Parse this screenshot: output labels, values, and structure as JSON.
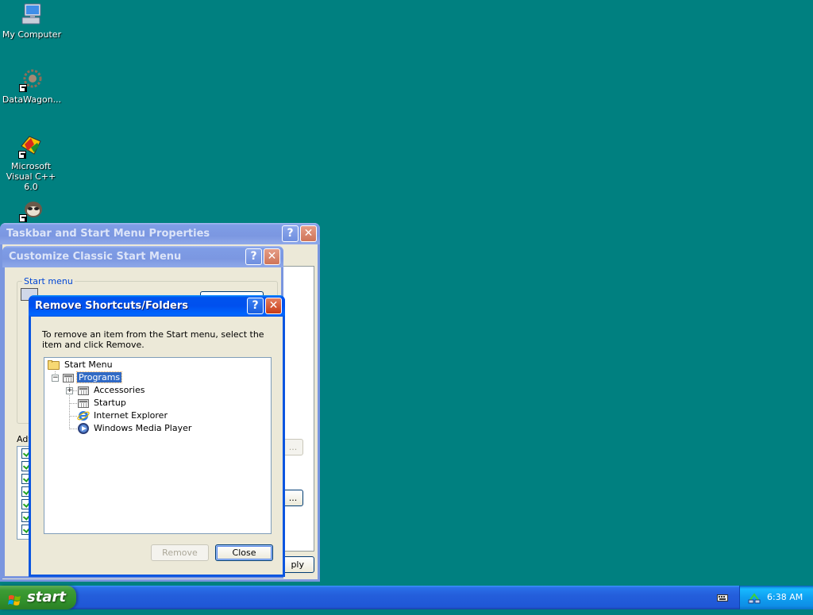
{
  "desktop": {
    "icons": [
      {
        "label": "My Computer",
        "icon": "my-computer-icon"
      },
      {
        "label": "DataWagon...",
        "icon": "datawagon-icon"
      },
      {
        "label": "Microsoft Visual C++ 6.0",
        "icon": "visual-cpp-icon"
      },
      {
        "label": "",
        "icon": "raccoon-app-icon"
      }
    ]
  },
  "taskbar_props": {
    "title": "Taskbar and Start Menu Properties",
    "apply_label": "ply",
    "ellipsis_button": "..."
  },
  "customize": {
    "title": "Customize Classic Start Menu",
    "start_menu_group": "Start menu",
    "advanced_label": "Adv",
    "ellipsis_button": "..."
  },
  "remove_dialog": {
    "title": "Remove Shortcuts/Folders",
    "instructions": "To remove an item from the Start menu, select the item and click Remove.",
    "tree": {
      "root": "Start Menu",
      "programs": "Programs",
      "children": [
        "Accessories",
        "Startup",
        "Internet Explorer",
        "Windows Media Player"
      ]
    },
    "remove_label": "Remove",
    "close_label": "Close"
  },
  "taskbar": {
    "start_label": "start",
    "clock": "6:38 AM"
  },
  "colors": {
    "desktop": "#008080",
    "titlebar_active": "#0053ee",
    "selection": "#316ac5",
    "start_button": "#3c9b34"
  }
}
